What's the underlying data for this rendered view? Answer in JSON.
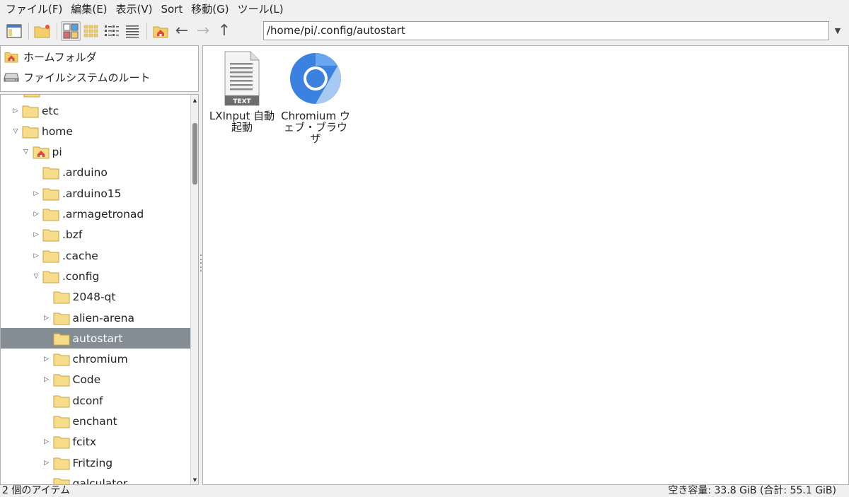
{
  "menu": [
    "ファイル(F)",
    "編集(E)",
    "表示(V)",
    "Sort",
    "移動(G)",
    "ツール(L)"
  ],
  "path": "/home/pi/.config/autostart",
  "places": [
    {
      "label": "ホームフォルダ",
      "icon": "home-folder-icon"
    },
    {
      "label": "ファイルシステムのルート",
      "icon": "drive-icon"
    }
  ],
  "tree": [
    {
      "label": "etc",
      "expander": "collapsed"
    },
    {
      "label": "home",
      "expander": "expanded"
    },
    {
      "label": "pi",
      "expander": "expanded",
      "home": true
    },
    {
      "label": ".arduino",
      "expander": "none"
    },
    {
      "label": ".arduino15",
      "expander": "collapsed"
    },
    {
      "label": ".armagetronad",
      "expander": "collapsed"
    },
    {
      "label": ".bzf",
      "expander": "collapsed"
    },
    {
      "label": ".cache",
      "expander": "collapsed"
    },
    {
      "label": ".config",
      "expander": "expanded"
    },
    {
      "label": "2048-qt",
      "expander": "none"
    },
    {
      "label": "alien-arena",
      "expander": "collapsed"
    },
    {
      "label": "autostart",
      "expander": "none",
      "selected": true
    },
    {
      "label": "chromium",
      "expander": "collapsed"
    },
    {
      "label": "Code",
      "expander": "collapsed"
    },
    {
      "label": "dconf",
      "expander": "none"
    },
    {
      "label": "enchant",
      "expander": "none"
    },
    {
      "label": "fcitx",
      "expander": "collapsed"
    },
    {
      "label": "Fritzing",
      "expander": "collapsed"
    },
    {
      "label": "galculator",
      "expander": "none"
    }
  ],
  "files": [
    {
      "name": "LXInput 自動起動",
      "icon": "text-file-icon",
      "badge": "TEXT"
    },
    {
      "name": "Chromium ウェブ・ブラウザ",
      "icon": "chromium-icon"
    }
  ],
  "status": {
    "items": "2 個のアイテム",
    "free": "空き容量: 33.8 GiB (合計: 55.1 GiB)"
  },
  "colors": {
    "selection": "#858d94",
    "folder": "#f7dc8c",
    "chromium_blue": "#3b82e0"
  }
}
